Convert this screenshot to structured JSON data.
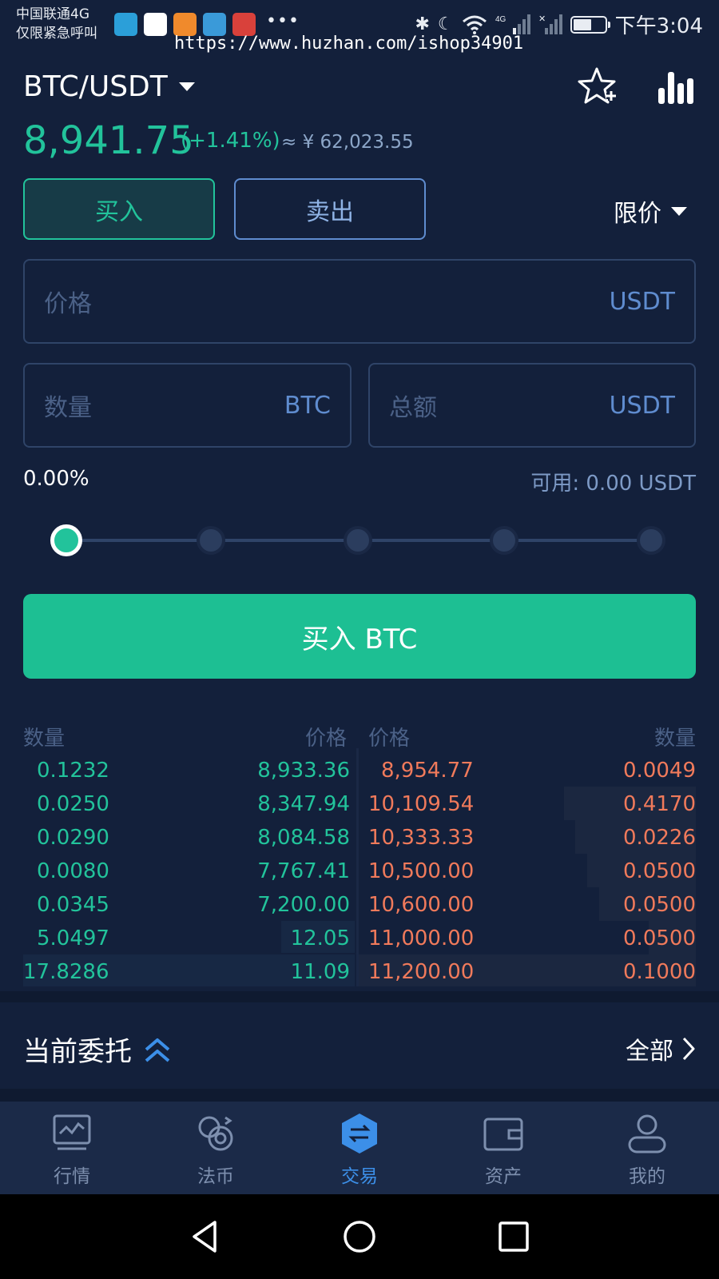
{
  "status_bar": {
    "carrier_line1": "中国联通4G",
    "carrier_line2": "仅限紧急呼叫",
    "time": "下午3:04",
    "network": "4G"
  },
  "watermark": "https://www.huzhan.com/ishop34901",
  "header": {
    "pair": "BTC/USDT"
  },
  "ticker": {
    "price": "8,941.75",
    "change": "(+1.41%)",
    "fiat": "≈ ¥ 62,023.55"
  },
  "tabs": {
    "buy": "买入",
    "sell": "卖出",
    "order_type": "限价"
  },
  "form": {
    "price_placeholder": "价格",
    "price_unit": "USDT",
    "amount_placeholder": "数量",
    "amount_unit": "BTC",
    "total_placeholder": "总额",
    "total_unit": "USDT",
    "percent": "0.00%",
    "available": "可用: 0.00 USDT",
    "slider_value": 0,
    "submit": "买入 BTC"
  },
  "orderbook": {
    "headers": {
      "bid_qty": "数量",
      "bid_price": "价格",
      "ask_price": "价格",
      "ask_qty": "数量"
    },
    "bids": [
      {
        "qty": "0.1232",
        "price": "8,933.36"
      },
      {
        "qty": "0.0250",
        "price": "8,347.94"
      },
      {
        "qty": "0.0290",
        "price": "8,084.58"
      },
      {
        "qty": "0.0080",
        "price": "7,767.41"
      },
      {
        "qty": "0.0345",
        "price": "7,200.00"
      },
      {
        "qty": "5.0497",
        "price": "12.05"
      },
      {
        "qty": "17.8286",
        "price": "11.09"
      }
    ],
    "asks": [
      {
        "price": "8,954.77",
        "qty": "0.0049"
      },
      {
        "price": "10,109.54",
        "qty": "0.4170"
      },
      {
        "price": "10,333.33",
        "qty": "0.0226"
      },
      {
        "price": "10,500.00",
        "qty": "0.0500"
      },
      {
        "price": "10,600.00",
        "qty": "0.0500"
      },
      {
        "price": "11,000.00",
        "qty": "0.0500"
      },
      {
        "price": "11,200.00",
        "qty": "0.1000"
      }
    ]
  },
  "entrust": {
    "title": "当前委托",
    "all": "全部"
  },
  "nav": {
    "items": [
      {
        "label": "行情",
        "icon": "market-icon"
      },
      {
        "label": "法币",
        "icon": "fiat-icon"
      },
      {
        "label": "交易",
        "icon": "trade-icon"
      },
      {
        "label": "资产",
        "icon": "wallet-icon"
      },
      {
        "label": "我的",
        "icon": "profile-icon"
      }
    ],
    "active": 2
  },
  "colors": {
    "background": "#13203b",
    "buy_green": "#22c39b",
    "sell_red": "#f07a5b",
    "accent_blue": "#3c8fe8"
  }
}
